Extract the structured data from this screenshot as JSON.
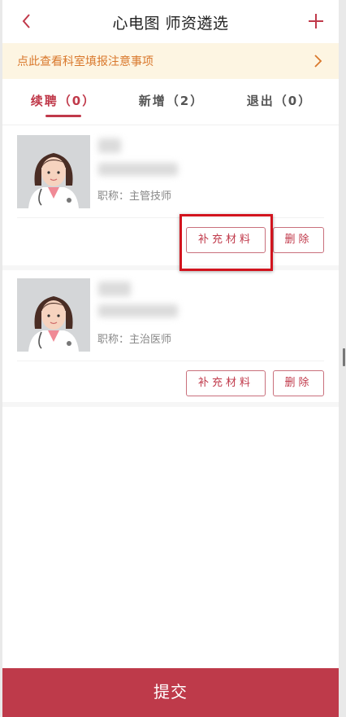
{
  "header": {
    "title": "心电图 师资遴选",
    "back_icon": "chevron-left-icon",
    "add_icon": "plus-icon"
  },
  "notice": {
    "text": "点此查看科室填报注意事项",
    "icon": "chevron-right-icon"
  },
  "tabs": [
    {
      "label": "续聘（0）",
      "active": true
    },
    {
      "label": "新增（2）",
      "active": false
    },
    {
      "label": "退出（0）",
      "active": false
    }
  ],
  "cards": [
    {
      "title_label": "职称：主管技师",
      "supplement_label": "补充材料",
      "delete_label": "删除"
    },
    {
      "title_label": "职称：主治医师",
      "supplement_label": "补充材料",
      "delete_label": "删除"
    }
  ],
  "submit_label": "提交",
  "colors": {
    "accent": "#be3a4a",
    "notice_bg": "#fdf5e2",
    "notice_text": "#d9782c",
    "highlight": "#d2141e"
  }
}
